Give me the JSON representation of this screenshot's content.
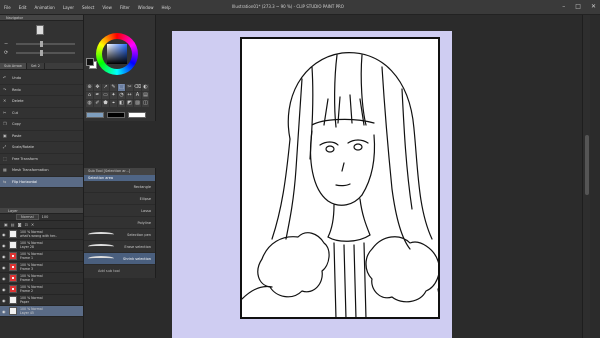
{
  "app": {
    "title": "Illustration01* (273.3 ~ 90 %) - CLIP STUDIO PAINT PRO",
    "menu": [
      "File",
      "Edit",
      "Animation",
      "Layer",
      "Select",
      "View",
      "Filter",
      "Window",
      "Help"
    ]
  },
  "navigator": {
    "title": "Navigator"
  },
  "subtool": {
    "tabs": [
      "Sub Arrow",
      "Set 2"
    ],
    "items": [
      {
        "label": "Undo",
        "icon": "undo-icon",
        "glyph": "↶"
      },
      {
        "label": "Redo",
        "icon": "redo-icon",
        "glyph": "↷"
      },
      {
        "label": "Delete",
        "icon": "delete-icon",
        "glyph": "✕"
      },
      {
        "label": "Cut",
        "icon": "scissors-icon",
        "glyph": "✂"
      },
      {
        "label": "Copy",
        "icon": "copy-icon",
        "glyph": "❐"
      },
      {
        "label": "Paste",
        "icon": "paste-icon",
        "glyph": "▣"
      },
      {
        "label": "Scale/Rotate",
        "icon": "scale-icon",
        "glyph": "⤢"
      },
      {
        "label": "Free Transform",
        "icon": "transform-icon",
        "glyph": "⬚"
      },
      {
        "label": "Mesh Transformation",
        "icon": "mesh-icon",
        "glyph": "▦"
      },
      {
        "label": "Flip Horizontal",
        "icon": "flip-icon",
        "glyph": "⇆"
      }
    ],
    "selected_index": 9
  },
  "tools": {
    "glyphs": [
      "⊕",
      "✥",
      "↗",
      "✎",
      "⬚",
      "✂",
      "⌫",
      "◐",
      "⌂",
      "✒",
      "▭",
      "✦",
      "◔",
      "↔",
      "A",
      "▤",
      "◍",
      "✐",
      "⬟",
      "⌖",
      "◧",
      "◩",
      "▨",
      "◫"
    ],
    "active_index": 4,
    "colors": [
      "#7f9fbf",
      "#000000",
      "#ffffff"
    ]
  },
  "tool_property": {
    "tab": "Sub Tool [Selection ar...]",
    "active_label": "Selection area",
    "rows": [
      "Rectangle",
      "Ellipse",
      "Lasso",
      "Polyline"
    ],
    "brushes": [
      "Selection pen",
      "Erase selection",
      "Shrink selection"
    ],
    "selected_brush_index": 2,
    "add_label": "Add sub tool"
  },
  "layers": {
    "title": "Layer",
    "blend_mode": "Normal",
    "opacity": "100",
    "rows": [
      {
        "line1": "100 % Normal",
        "line2": "what's wrong with her..",
        "thumb": "plain",
        "selected": false
      },
      {
        "line1": "100 % Normal",
        "line2": "Layer 28",
        "thumb": "plain",
        "selected": false
      },
      {
        "line1": "100 % Normal",
        "line2": "Frame 1",
        "thumb": "red",
        "selected": false
      },
      {
        "line1": "100 % Normal",
        "line2": "Frame 3",
        "thumb": "red",
        "selected": false
      },
      {
        "line1": "100 % Normal",
        "line2": "Frame 4",
        "thumb": "red",
        "selected": false
      },
      {
        "line1": "100 % Normal",
        "line2": "Frame 2",
        "thumb": "red",
        "selected": false
      },
      {
        "line1": "100 % Normal",
        "line2": "Paper",
        "thumb": "plain",
        "selected": false
      },
      {
        "line1": "100 % Normal",
        "line2": "Layer 45",
        "thumb": "plain",
        "selected": true
      }
    ]
  }
}
